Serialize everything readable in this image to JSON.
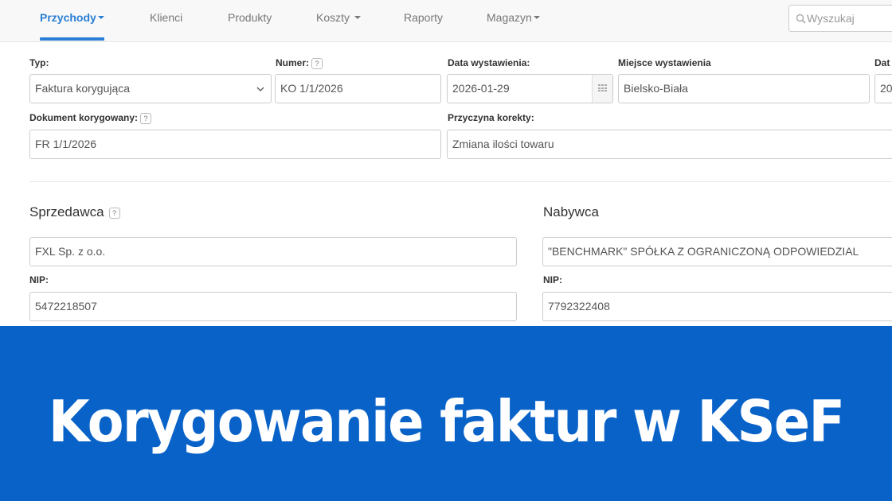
{
  "nav": {
    "items": [
      {
        "label": "Przychody",
        "active": true,
        "dropdown": true
      },
      {
        "label": "Klienci",
        "active": false,
        "dropdown": false
      },
      {
        "label": "Produkty",
        "active": false,
        "dropdown": false
      },
      {
        "label": "Koszty",
        "active": false,
        "dropdown": true
      },
      {
        "label": "Raporty",
        "active": false,
        "dropdown": false
      },
      {
        "label": "Magazyn",
        "active": false,
        "dropdown": true
      }
    ],
    "search_placeholder": "Wyszukaj"
  },
  "form": {
    "typ_label": "Typ:",
    "typ_value": "Faktura korygująca",
    "numer_label": "Numer:",
    "numer_value": "KO 1/1/2026",
    "data_wystawienia_label": "Data wystawienia:",
    "data_wystawienia_value": "2026-01-29",
    "miejsce_label": "Miejsce wystawienia",
    "miejsce_value": "Bielsko-Biała",
    "data_cut_label": "Dat",
    "data_cut_value": "20",
    "dokument_label": "Dokument korygowany:",
    "dokument_value": "FR 1/1/2026",
    "przyczyna_label": "Przyczyna korekty:",
    "przyczyna_value": "Zmiana ilości towaru",
    "help_glyph": "?"
  },
  "sprzedawca": {
    "title": "Sprzedawca",
    "name_value": "FXL Sp. z o.o.",
    "nip_label": "NIP:",
    "nip_value": "5472218507"
  },
  "nabywca": {
    "title": "Nabywca",
    "name_value": "\"BENCHMARK\" SPÓŁKA Z OGRANICZONĄ ODPOWIEDZIAL",
    "nip_label": "NIP:",
    "nip_value": "7792322408"
  },
  "banner": {
    "title": "Korygowanie faktur w KSeF",
    "color": "#0862c8"
  },
  "colors": {
    "accent": "#2a7fd4",
    "banner": "#0862c8"
  }
}
